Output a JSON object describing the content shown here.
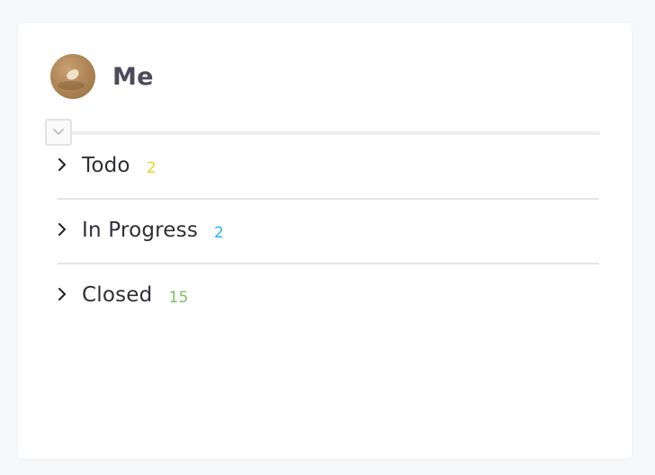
{
  "user": {
    "name": "Me",
    "avatar_icon": "user-avatar-photo"
  },
  "toggle": {
    "icon": "chevron-down-icon"
  },
  "groups": [
    {
      "label": "Todo",
      "count": "2",
      "color": "#f2d21b",
      "icon": "chevron-right-icon"
    },
    {
      "label": "In Progress",
      "count": "2",
      "color": "#2ab1ef",
      "icon": "chevron-right-icon"
    },
    {
      "label": "Closed",
      "count": "15",
      "color": "#79c25a",
      "icon": "chevron-right-icon"
    }
  ]
}
